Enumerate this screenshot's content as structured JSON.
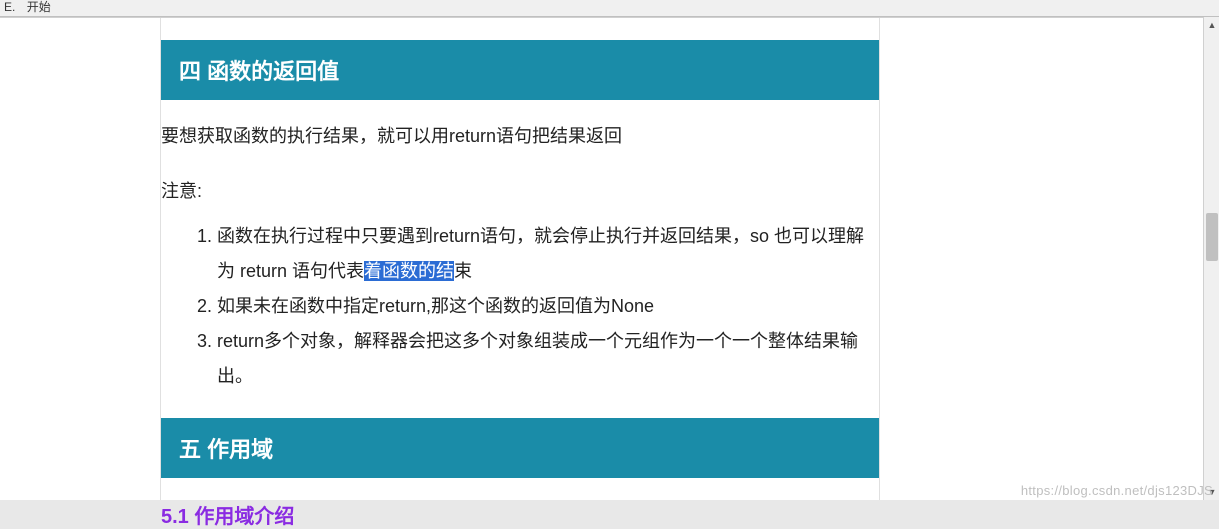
{
  "titlebar": {
    "menu1": "E.",
    "menu2": "开始"
  },
  "section4": {
    "heading": "四 函数的返回值",
    "intro": "要想获取函数的执行结果，就可以用return语句把结果返回",
    "note_label": "注意:",
    "items": {
      "item1_pre": "函数在执行过程中只要遇到return语句，就会停止执行并返回结果，so 也可以理解为 return 语句代表",
      "item1_highlight": "着函数的结",
      "item1_post": "束",
      "item2": "如果未在函数中指定return,那这个函数的返回值为None",
      "item3": "return多个对象，解释器会把这多个对象组装成一个元组作为一个一个整体结果输出。"
    }
  },
  "section5": {
    "heading": "五 作用域",
    "sub1": "5.1 作用域介绍"
  },
  "watermark": "https://blog.csdn.net/djs123DJS"
}
